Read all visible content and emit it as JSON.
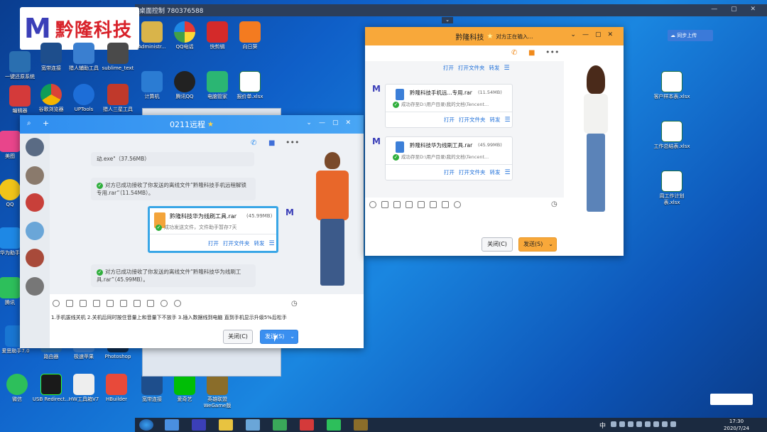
{
  "remote_bar": {
    "title": "桌面控制 780376588"
  },
  "logo": {
    "mark": "M",
    "text": "黔隆科技"
  },
  "desktop_icons_left": [
    {
      "label": "一键还原系统"
    },
    {
      "label": "宽带连接"
    },
    {
      "label": "猎人辅助工具"
    },
    {
      "label": "sublime_text"
    },
    {
      "label": "谷歌浏览器"
    },
    {
      "label": "UPTools"
    },
    {
      "label": "猎人三星工具"
    },
    {
      "label": "美图"
    },
    {
      "label": "QQ"
    },
    {
      "label": "华为助手"
    },
    {
      "label": "腾讯"
    },
    {
      "label": "爱思助手7.0"
    },
    {
      "label": "路由器"
    },
    {
      "label": "极速苹果"
    },
    {
      "label": "Photoshop"
    },
    {
      "label": "微信"
    },
    {
      "label": "USB Redirect..."
    },
    {
      "label": "HW工具箱V7"
    },
    {
      "label": "HBuilder"
    }
  ],
  "desktop_icons_remote": [
    {
      "label": "Administr..."
    },
    {
      "label": "QQ电话"
    },
    {
      "label": "快剪辑"
    },
    {
      "label": "向日葵"
    },
    {
      "label": "计算机"
    },
    {
      "label": "腾讯QQ"
    },
    {
      "label": "电脑管家"
    },
    {
      "label": "报价单.xlsx"
    },
    {
      "label": "宽带连接"
    },
    {
      "label": "爱奇艺"
    },
    {
      "label": "英雄联盟 WeGame版"
    }
  ],
  "desktop_icons_right": [
    {
      "label": "客户样本表.xlsx"
    },
    {
      "label": "工作总结表.xlsx"
    },
    {
      "label": "周工作计划表.xlsx"
    }
  ],
  "cloud_button": {
    "label": "同步上传"
  },
  "left_chat": {
    "title": "0211远程",
    "msg1_text": "动.exe\"（37.56MB）",
    "msg2_text": "对方已成功接收了你发送的离线文件“黔隆科技手机远程解锁专用.rar”（11.54MB）。",
    "file_name": "黔隆科技华为线刷工具.rar",
    "file_size": "(45.99MB)",
    "file_status": "成功发送文件，文件助手暂存7天",
    "file_actions": [
      "打开",
      "打开文件夹",
      "转发"
    ],
    "msg3_text": "对方已成功接收了你发送的离线文件“黔隆科技华为线刷工具.rar”（45.99MB）。",
    "input_text": "1.手机拔线关机 2.关机后同时按住音量上和音量下不放手 3.插入数据线到电脑 直到手机显示升级5%后松手",
    "close_label": "关闭(C)",
    "send_label": "发送(S)"
  },
  "right_chat": {
    "title": "黔隆科技",
    "typing": "对方正在输入...",
    "top_actions": [
      "打开",
      "打开文件夹",
      "转发"
    ],
    "file1_name": "黔隆科技手机远...专用.rar",
    "file1_size": "(11.54MB)",
    "file1_status": "成功存至D:\\用户目录\\我的文档\\Tencent...",
    "file1_actions": [
      "打开",
      "打开文件夹",
      "转发"
    ],
    "file2_name": "黔隆科技华为线刷工具.rar",
    "file2_size": "(45.99MB)",
    "file2_status": "成功存至D:\\用户目录\\我的文档\\Tencent...",
    "file2_actions": [
      "打开",
      "打开文件夹",
      "转发"
    ],
    "close_label": "关闭(C)",
    "send_label": "发送(S)"
  },
  "tray": {
    "time": "17:30",
    "date": "2020/7/24",
    "ime": "中"
  },
  "colors": {
    "accent_orange": "#f8a83a",
    "blue_link": "#1e6fd9",
    "success": "#2fae3c"
  }
}
